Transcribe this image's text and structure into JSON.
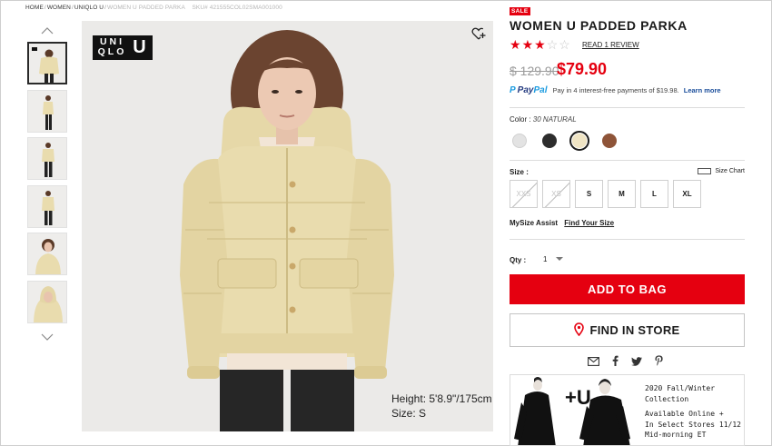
{
  "breadcrumb": {
    "items": [
      {
        "label": "HOME",
        "current": false
      },
      {
        "label": "WOMEN",
        "current": false
      },
      {
        "label": "UNIQLO U",
        "current": false
      },
      {
        "label": "WOMEN U PADDED PARKA",
        "current": true
      }
    ],
    "separator": "/",
    "sku": "SKU# 421555COL02SMA001000"
  },
  "gallery": {
    "thumbnail_count": 6,
    "active_index": 0,
    "brand_logo_text": "UNI QLO",
    "brand_logo_line1": "UNI",
    "brand_logo_line2": "QLO",
    "sub_logo_text": "U",
    "model_height": "Height: 5'8.9\"/175cm",
    "model_size": "Size: S",
    "icons": {
      "prev": "chevron-up-icon",
      "next": "chevron-down-icon",
      "wishlist": "heart-plus-icon"
    }
  },
  "product": {
    "badge": "SALE",
    "title": "WOMEN U PADDED PARKA",
    "rating": 3,
    "rating_max": 5,
    "review_link": "READ 1 REVIEW",
    "price_original": "$ 129.90",
    "price_sale": "$79.90",
    "paypal": {
      "logo_pay": "Pay",
      "logo_pal": "Pal",
      "message": "Pay in 4 interest-free payments of $19.98.",
      "link": "Learn more"
    },
    "color": {
      "label": "Color :",
      "selected_name": "30 NATURAL",
      "swatches": [
        {
          "name": "light-gray",
          "hex": "#e3e3e3",
          "selected": false
        },
        {
          "name": "black",
          "hex": "#2d2d2d",
          "selected": false
        },
        {
          "name": "natural",
          "hex": "#efe4c4",
          "selected": true
        },
        {
          "name": "brown",
          "hex": "#8e5438",
          "selected": false
        }
      ]
    },
    "size": {
      "label": "Size :",
      "chart_label": "Size Chart",
      "options": [
        {
          "label": "XXS",
          "available": false
        },
        {
          "label": "XS",
          "available": false
        },
        {
          "label": "S",
          "available": true
        },
        {
          "label": "M",
          "available": true
        },
        {
          "label": "L",
          "available": true
        },
        {
          "label": "XL",
          "available": true
        }
      ],
      "assist_label": "MySize Assist",
      "assist_link": "Find Your Size"
    },
    "quantity": {
      "label": "Qty :",
      "value": "1"
    },
    "add_to_bag": "ADD TO BAG",
    "find_in_store": "FIND IN STORE",
    "share_icons": [
      "mail-icon",
      "facebook-icon",
      "twitter-icon",
      "pinterest-icon"
    ]
  },
  "promo": {
    "line1": "2020 Fall/Winter",
    "line2": "Collection",
    "line3": "Available Online +",
    "line4": "In Select Stores 11/12",
    "line5": "Mid-morning ET",
    "logo_text": "+U"
  },
  "colors": {
    "accent_red": "#e50010",
    "paypal_blue": "#243b80",
    "paypal_light": "#1b9be0",
    "link_blue": "#1b4e9b"
  }
}
